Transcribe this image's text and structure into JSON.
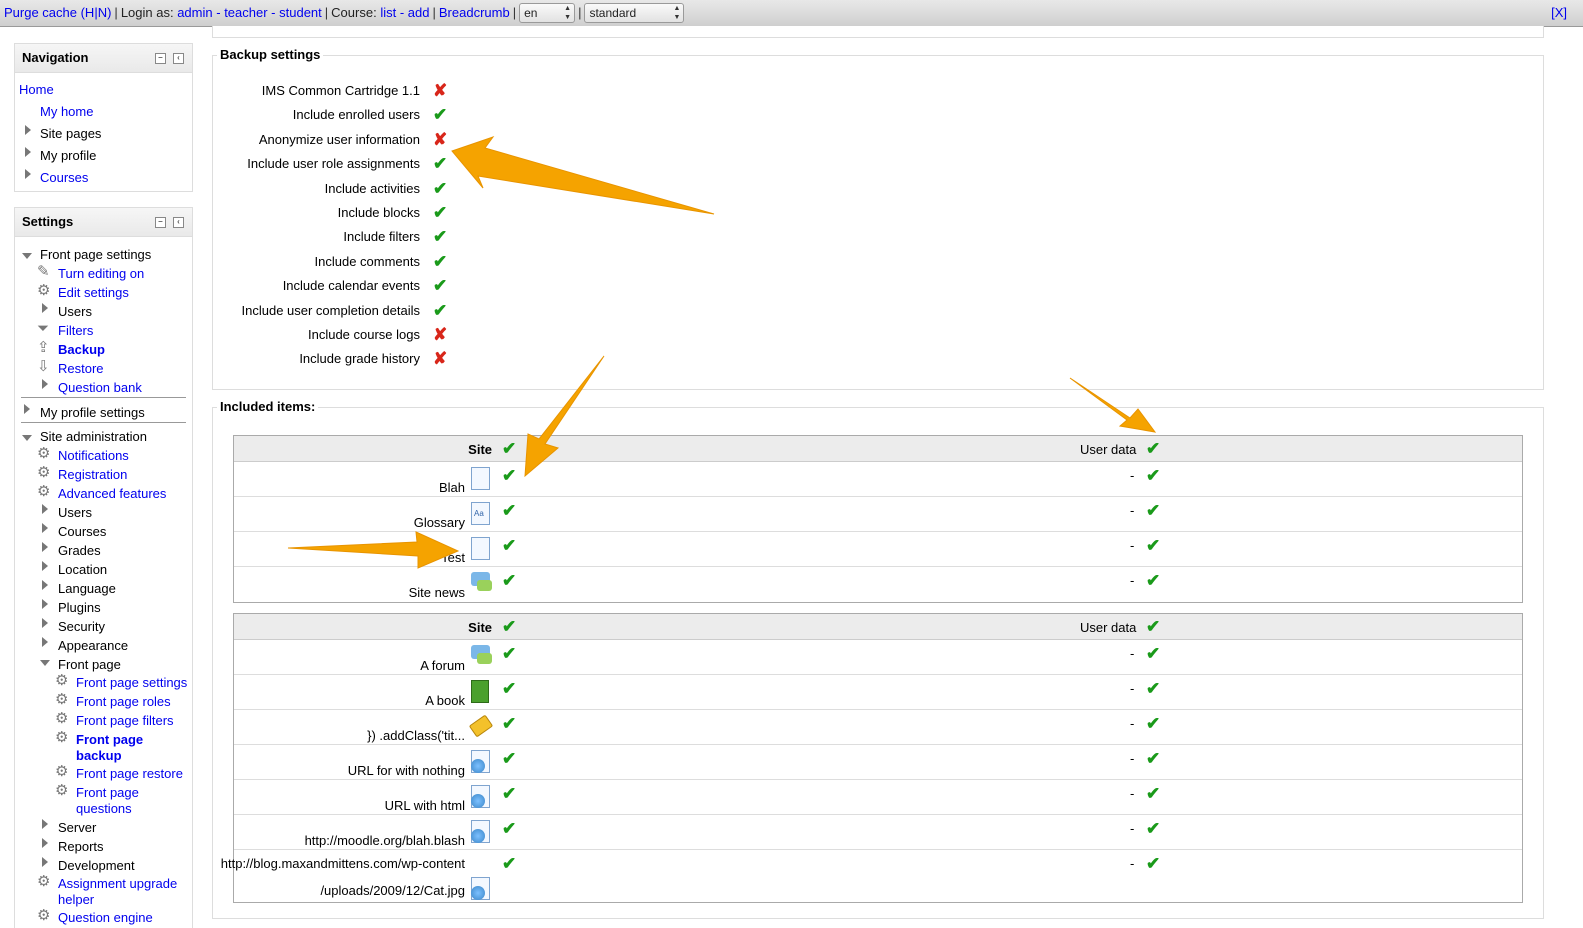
{
  "topbar": {
    "purge": "Purge cache (H|N)",
    "login_as": "Login as:",
    "admin": "admin",
    "teacher": "teacher",
    "student": "student",
    "course": "Course:",
    "list": "list",
    "add": "add",
    "breadcrumb": "Breadcrumb",
    "lang": "en",
    "theme": "standard",
    "close": "[X]"
  },
  "navigation": {
    "title": "Navigation",
    "home": "Home",
    "items": [
      "My home",
      "Site pages",
      "My profile",
      "Courses"
    ]
  },
  "settings": {
    "title": "Settings",
    "front_page_settings": "Front page settings",
    "fp_items": [
      "Turn editing on",
      "Edit settings",
      "Users",
      "Filters",
      "Backup",
      "Restore",
      "Question bank"
    ],
    "my_profile_settings": "My profile settings",
    "site_admin": "Site administration",
    "sa_items": [
      "Notifications",
      "Registration",
      "Advanced features",
      "Users",
      "Courses",
      "Grades",
      "Location",
      "Language",
      "Plugins",
      "Security",
      "Appearance",
      "Front page"
    ],
    "fp_sub": [
      "Front page settings",
      "Front page roles",
      "Front page filters",
      "Front page",
      "backup",
      "Front page restore",
      "Front page",
      "questions"
    ],
    "sa_after": [
      "Server",
      "Reports",
      "Development",
      "Assignment upgrade",
      "helper",
      "Question engine"
    ]
  },
  "backup_settings": {
    "title": "Backup settings",
    "rows": [
      {
        "label": "IMS Common Cartridge 1.1",
        "on": false
      },
      {
        "label": "Include enrolled users",
        "on": true
      },
      {
        "label": "Anonymize user information",
        "on": false
      },
      {
        "label": "Include user role assignments",
        "on": true
      },
      {
        "label": "Include activities",
        "on": true
      },
      {
        "label": "Include blocks",
        "on": true
      },
      {
        "label": "Include filters",
        "on": true
      },
      {
        "label": "Include comments",
        "on": true
      },
      {
        "label": "Include calendar events",
        "on": true
      },
      {
        "label": "Include user completion details",
        "on": true
      },
      {
        "label": "Include course logs",
        "on": false
      },
      {
        "label": "Include grade history",
        "on": false
      }
    ]
  },
  "included": {
    "title": "Included items:",
    "site_label": "Site",
    "user_data_label": "User data",
    "dash": "-",
    "table1": [
      "Blah",
      "Glossary",
      "Test",
      "Site news"
    ],
    "table2": [
      "A forum",
      "A book",
      "}) .addClass('tit...",
      "URL for with nothing",
      "URL with html",
      "http://moodle.org/blah.blash",
      "http://blog.maxandmittens.com/wp-content",
      "/uploads/2009/12/Cat.jpg"
    ]
  },
  "colors": {
    "check": "#1a9a1a",
    "cross": "#d8261a",
    "arrow": "#f5a300"
  }
}
